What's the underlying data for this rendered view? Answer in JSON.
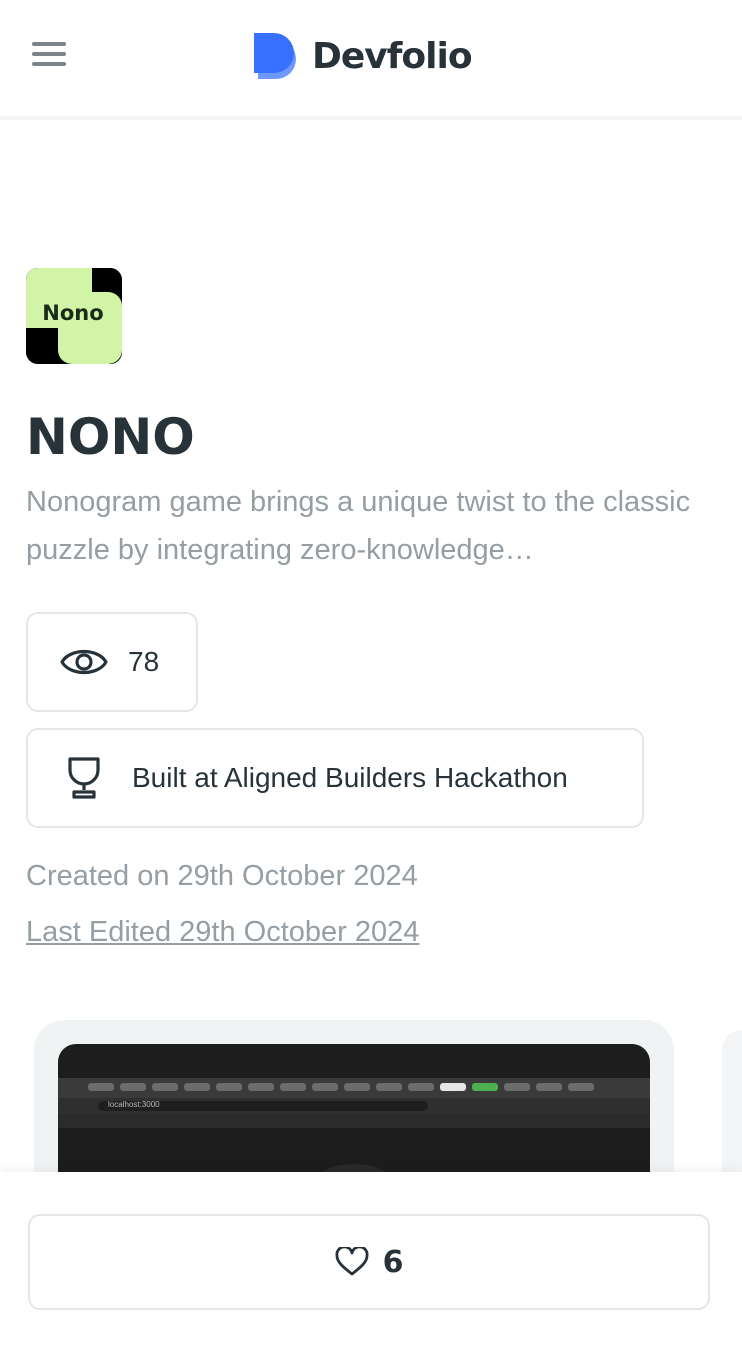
{
  "header": {
    "brand_name": "Devfolio",
    "brand_color": "#3770ff"
  },
  "project": {
    "logo_text": "Nono",
    "logo_colors": {
      "light": "#d2f4a7",
      "dark": "#000000"
    },
    "title": "NONO",
    "description": "Nonogram game brings a unique twist to the classic puzzle by integrating zero-knowledge…",
    "views": "78",
    "hackathon": "Built at Aligned Builders Hackathon",
    "created": "Created on 29th October 2024",
    "last_edited": "Last Edited 29th October 2024"
  },
  "preview": {
    "url_text": "localhost:3000"
  },
  "footer": {
    "likes": "6"
  }
}
